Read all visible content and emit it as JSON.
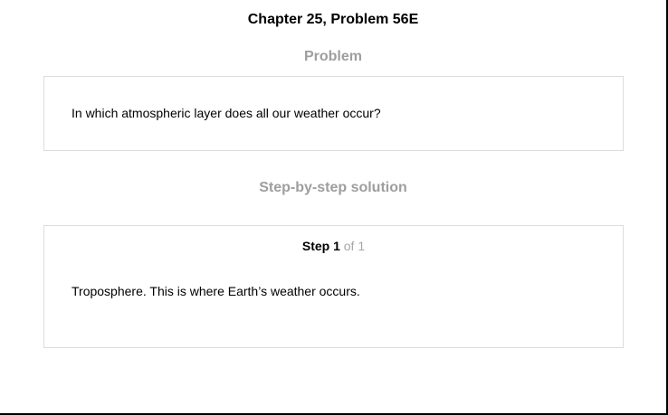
{
  "header": {
    "title": "Chapter 25, Problem 56E"
  },
  "problem": {
    "heading": "Problem",
    "text": "In which atmospheric layer does all our weather occur?"
  },
  "solution": {
    "heading": "Step-by-step solution",
    "step": {
      "label": "Step 1",
      "count": "of 1",
      "text": "Troposphere. This is where Earth’s weather occurs."
    }
  }
}
